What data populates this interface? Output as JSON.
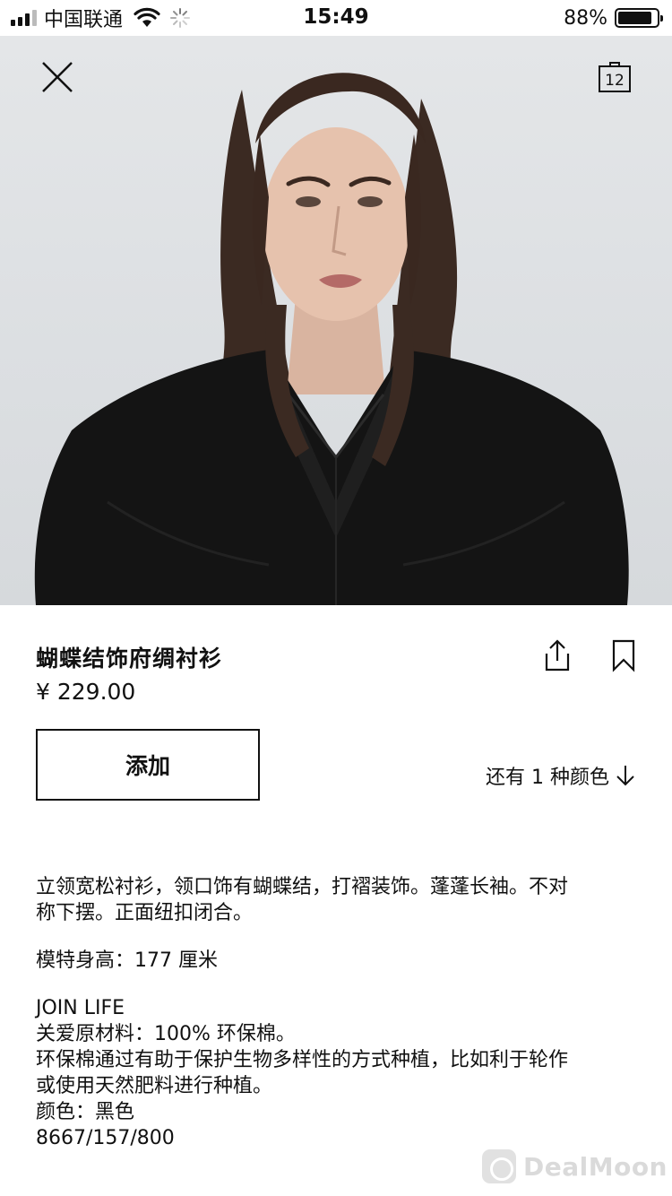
{
  "status_bar": {
    "carrier": "中国联通",
    "time": "15:49",
    "battery_percent": "88%",
    "battery_level": 0.88
  },
  "header": {
    "close_icon": "close-icon",
    "bag_icon": "shopping-bag-icon",
    "bag_count": "12"
  },
  "product": {
    "title": "蝴蝶结饰府绸衬衫",
    "price": "¥ 229.00",
    "add_label": "添加",
    "more_colors_label": "还有 1 种颜色",
    "description_lines": [
      "立领宽松衬衫，领口饰有蝴蝶结，打褶装饰。蓬蓬长袖。不对",
      "称下摆。正面纽扣闭合。"
    ],
    "model_height": "模特身高：177 厘米",
    "join_life": "JOIN LIFE",
    "material": "关爱原材料：100% 环保棉。",
    "cotton_lines": [
      "环保棉通过有助于保护生物多样性的方式种植，比如利于轮作",
      "或使用天然肥料进行种植。"
    ],
    "color": "颜色：黑色",
    "ref": "8667/157/800"
  },
  "watermark": {
    "text": "DealMoon"
  }
}
